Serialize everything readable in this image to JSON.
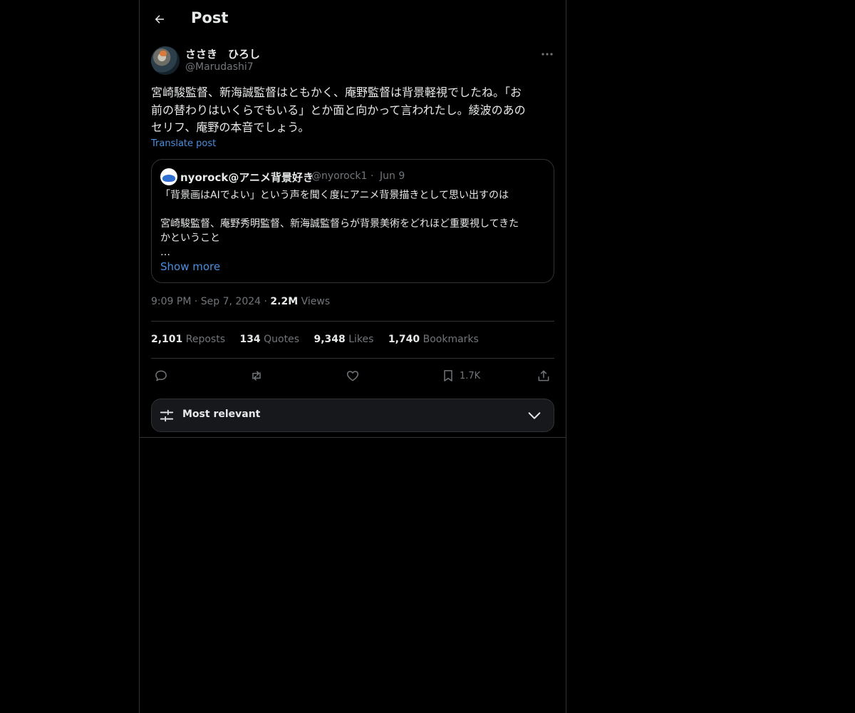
{
  "header": {
    "title": "Post"
  },
  "post": {
    "author": {
      "display_name": "ささき　ひろし",
      "handle": "@Marudashi7"
    },
    "text_lines": [
      "宮崎駿監督、新海誠監督はともかく、庵野監督は背景軽視でしたね。「お",
      "前の替わりはいくらでもいる」とか面と向かって言われたし。綾波のあの",
      "セリフ、庵野の本音でしょう。"
    ],
    "translate_label": "Translate post",
    "time": "9:09 PM",
    "date": "Sep 7, 2024",
    "views_count": "2.2M",
    "views_label": "Views"
  },
  "quote": {
    "display_name": "nyorock@アニメ背景好き",
    "handle": "@nyorock1",
    "date": "Jun 9",
    "lines": [
      "「背景画はAIでよい」という声を聞く度にアニメ背景描きとして思い出すのは",
      "",
      "宮崎駿監督、庵野秀明監督、新海誠監督らが背景美術をどれほど重要視してきた",
      "かということ",
      "…"
    ],
    "show_more": "Show more"
  },
  "stats": [
    {
      "count": "2,101",
      "label": "Reposts"
    },
    {
      "count": "134",
      "label": "Quotes"
    },
    {
      "count": "9,348",
      "label": "Likes"
    },
    {
      "count": "1,740",
      "label": "Bookmarks"
    }
  ],
  "actions": {
    "bookmark_count": "1.7K",
    "icons": [
      "reply-icon",
      "repost-icon",
      "like-icon",
      "bookmark-icon",
      "share-icon"
    ]
  },
  "sort": {
    "label": "Most relevant"
  },
  "colors": {
    "background": "#000000",
    "text": "#e7e9ea",
    "muted": "#71767b",
    "link": "#4a8fe0",
    "border": "#2f3336"
  }
}
